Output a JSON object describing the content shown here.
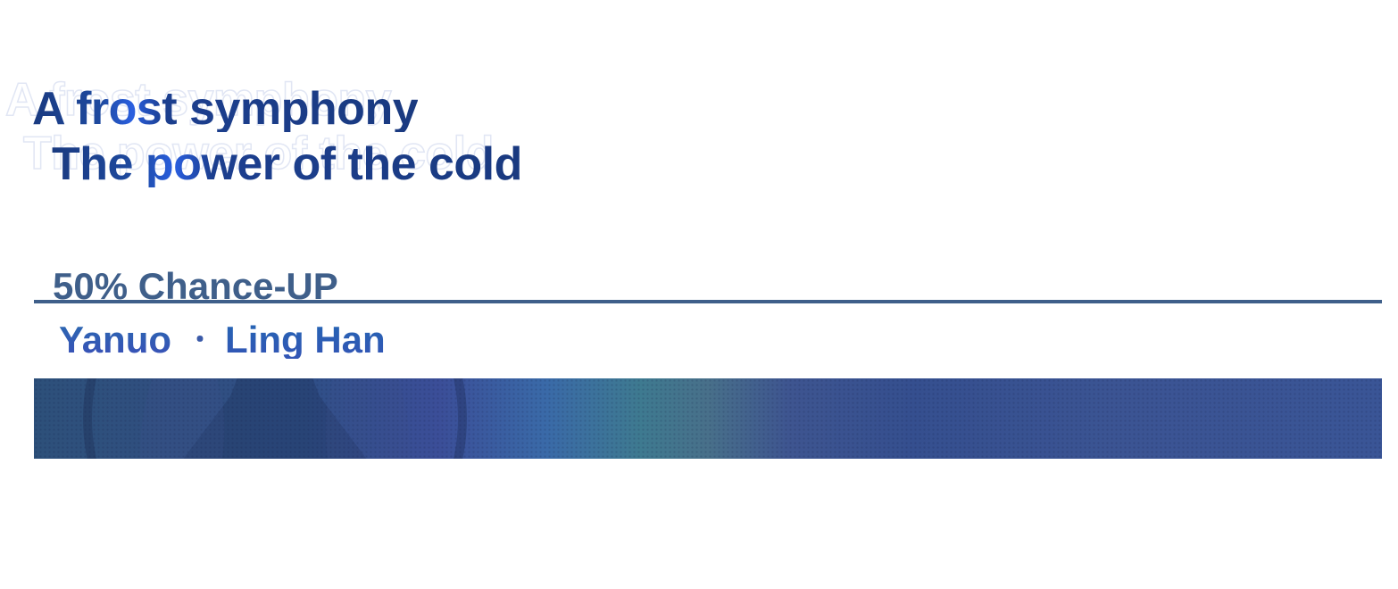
{
  "title": {
    "line1": "A frost symphony",
    "line2": "The power of the cold"
  },
  "rate_up": {
    "label": "50% Chance-UP"
  },
  "characters": {
    "first": "Yanuo",
    "separator": "・",
    "second": "Ling Han"
  },
  "colors": {
    "title_primary": "#1a3a80",
    "title_accent": "#2a5fe0",
    "divider": "#3f5f8a",
    "character_name": "#2a69b0",
    "banner": "#354f8f"
  }
}
